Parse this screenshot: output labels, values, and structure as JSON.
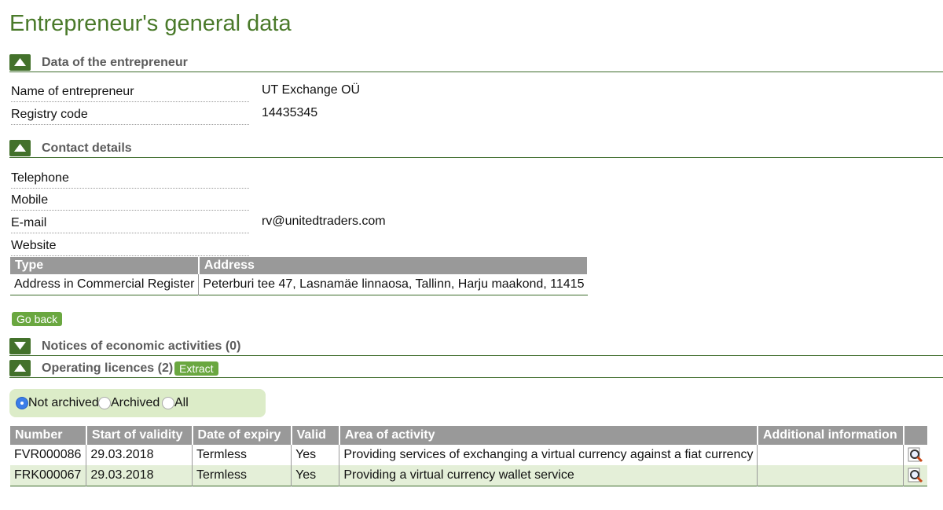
{
  "page": {
    "title": "Entrepreneur's general data"
  },
  "sections": {
    "entrepreneur": "Data of the entrepreneur",
    "contact": "Contact details",
    "notices": "Notices of economic activities (0)",
    "licences": "Operating licences (2)"
  },
  "entrepreneur": {
    "name_label": "Name of entrepreneur",
    "name_value": "UT Exchange OÜ",
    "registry_label": "Registry code",
    "registry_value": "14435345"
  },
  "contact": {
    "telephone_label": "Telephone",
    "mobile_label": "Mobile",
    "email_label": "E-mail",
    "email_value": "rv@unitedtraders.com",
    "website_label": "Website"
  },
  "address_table": {
    "headers": [
      "Type",
      "Address"
    ],
    "rows": [
      [
        "Address in Commercial Register",
        "Peterburi tee 47, Lasnamäe linnaosa, Tallinn, Harju maakond, 11415"
      ]
    ]
  },
  "buttons": {
    "go_back": "Go back",
    "extract": "Extract"
  },
  "filter": {
    "options": [
      "Not archived",
      "Archived",
      "All"
    ],
    "selected": "Not archived"
  },
  "licences_table": {
    "headers": [
      "Number",
      "Start of validity",
      "Date of expiry",
      "Valid",
      "Area of activity",
      "Additional information",
      ""
    ],
    "rows": [
      [
        "FVR000086",
        "29.03.2018",
        "Termless",
        "Yes",
        "Providing services of exchanging a virtual currency against a fiat currency",
        ""
      ],
      [
        "FRK000067",
        "29.03.2018",
        "Termless",
        "Yes",
        "Providing a virtual currency wallet service",
        ""
      ]
    ]
  },
  "icons": {
    "collapse": "triangle-up-icon",
    "expand": "triangle-down-icon",
    "details": "magnifier-icon"
  },
  "colors": {
    "title_green": "#4a7a2a",
    "toggle_green": "#43712b",
    "button_green": "#6aa740",
    "header_gray": "#999999",
    "row_alt": "#e4efd8",
    "filter_bg": "#dcecc8",
    "radio_selected": "#3b7de8"
  }
}
